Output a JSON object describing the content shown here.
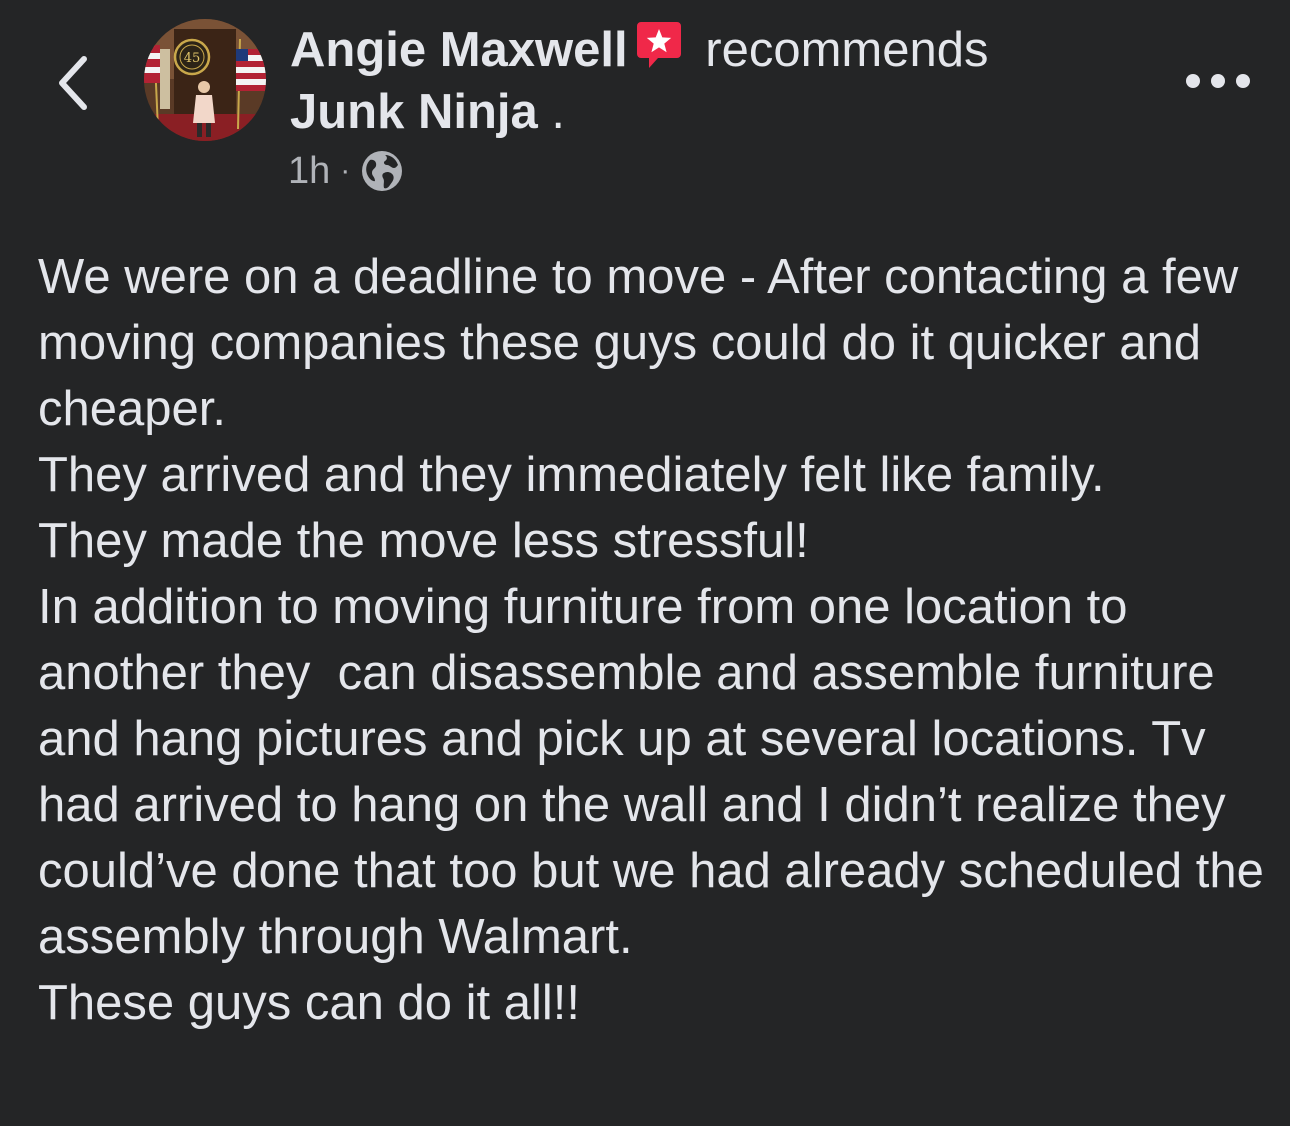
{
  "header": {
    "author": "Angie Maxwell",
    "action": "recommends",
    "page": "Junk Ninja",
    "page_suffix": " .",
    "timestamp": "1h",
    "separator": "·",
    "audience_icon": "globe-icon",
    "back_icon": "chevron-left-icon",
    "more_icon": "more-horizontal-icon",
    "badge_icon": "recommendation-star-icon"
  },
  "post": {
    "lines": [
      "We were on a deadline to move - After contacting a few moving companies these guys could do it quicker and cheaper.",
      "They arrived and they immediately felt like family.",
      "They made the move less stressful!",
      "In addition to moving furniture from one location to another they  can disassemble and assemble furniture and hang pictures and pick up at several locations. Tv had arrived to hang on the wall and I didn’t realize they could’ve done that too but we had already scheduled the assembly through Walmart.",
      "These guys can do it all!!"
    ]
  },
  "colors": {
    "background": "#242526",
    "text_primary": "#e4e6eb",
    "text_secondary": "#b0b3b8",
    "badge": "#f02849"
  }
}
